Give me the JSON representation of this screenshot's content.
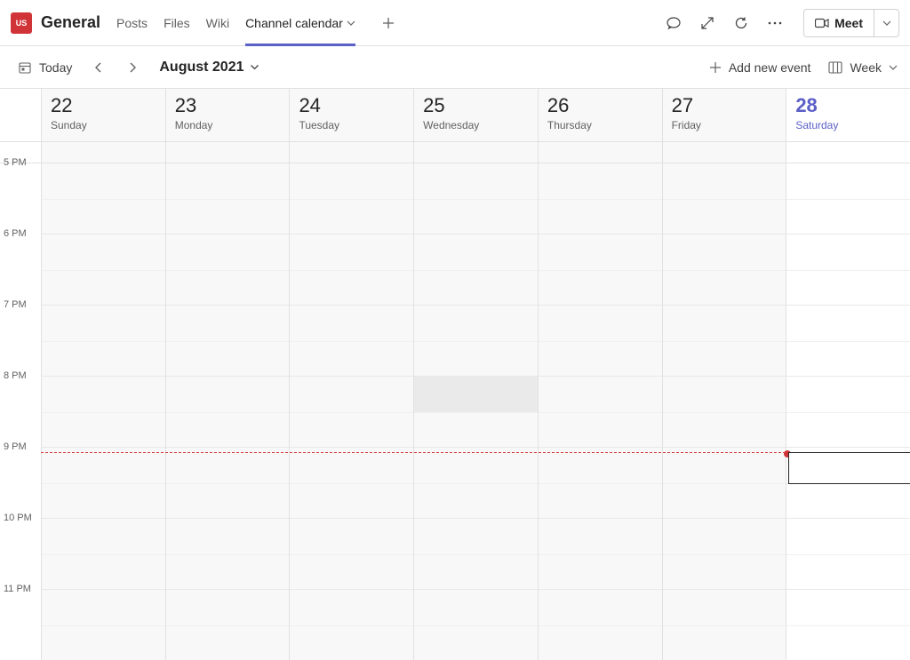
{
  "header": {
    "avatar_initials": "US",
    "channel_name": "General",
    "tabs": [
      {
        "label": "Posts",
        "active": false
      },
      {
        "label": "Files",
        "active": false
      },
      {
        "label": "Wiki",
        "active": false
      },
      {
        "label": "Channel calendar",
        "active": true,
        "has_dropdown": true
      }
    ],
    "meet_label": "Meet"
  },
  "toolbar": {
    "today_label": "Today",
    "month_label": "August 2021",
    "add_event_label": "Add new event",
    "view_label": "Week"
  },
  "calendar": {
    "days": [
      {
        "num": "22",
        "name": "Sunday",
        "is_today": false
      },
      {
        "num": "23",
        "name": "Monday",
        "is_today": false
      },
      {
        "num": "24",
        "name": "Tuesday",
        "is_today": false
      },
      {
        "num": "25",
        "name": "Wednesday",
        "is_today": false
      },
      {
        "num": "26",
        "name": "Thursday",
        "is_today": false
      },
      {
        "num": "27",
        "name": "Friday",
        "is_today": false
      },
      {
        "num": "28",
        "name": "Saturday",
        "is_today": true
      }
    ],
    "time_labels": [
      "5 PM",
      "6 PM",
      "7 PM",
      "8 PM",
      "9 PM",
      "10 PM",
      "11 PM"
    ],
    "now_indicator": {
      "hour_index": 4,
      "minute_fraction": 0.06
    },
    "selected_cell": {
      "day_index": 3,
      "hour_index": 3
    },
    "create_slot": {
      "day_index": 6,
      "hour_index": 4
    }
  }
}
